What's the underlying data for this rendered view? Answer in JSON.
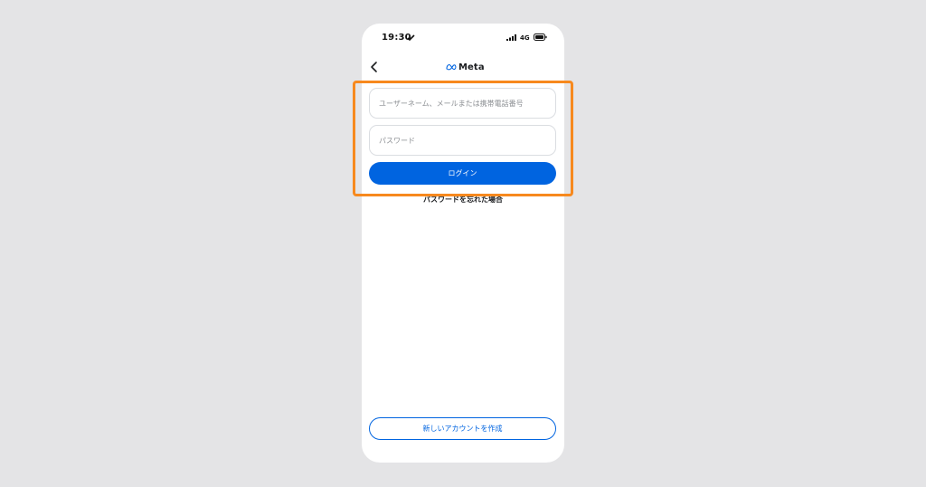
{
  "status_bar": {
    "time": "19:30",
    "network": "4G",
    "icons": [
      "moon-icon",
      "signal-icon",
      "battery-icon"
    ]
  },
  "nav": {
    "back_icon": "chevron-left-icon",
    "brand_logo": "meta-logo-icon",
    "brand_name": "Meta"
  },
  "form": {
    "username_placeholder": "ユーザーネーム、メールまたは携帯電話番号",
    "username_value": "",
    "password_placeholder": "パスワード",
    "password_value": "",
    "login_label": "ログイン"
  },
  "forgot_password": "パスワードを忘れた場合",
  "create_account": "新しいアカウントを作成",
  "colors": {
    "primary": "#0064e0",
    "highlight": "#f7891e",
    "background": "#e4e4e6"
  }
}
